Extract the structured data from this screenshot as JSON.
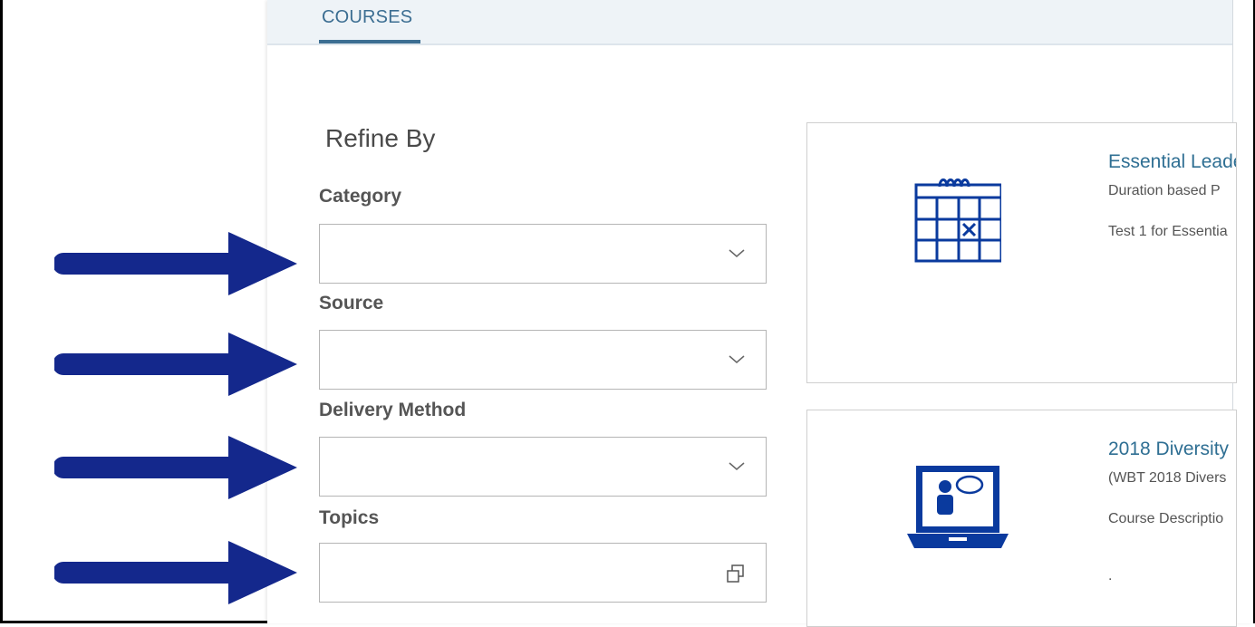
{
  "tabs": {
    "active_label": "COURSES"
  },
  "refine": {
    "title": "Refine By",
    "filters": [
      {
        "label": "Category",
        "value": "",
        "control": "dropdown"
      },
      {
        "label": "Source",
        "value": "",
        "control": "dropdown"
      },
      {
        "label": "Delivery Method",
        "value": "",
        "control": "dropdown"
      },
      {
        "label": "Topics",
        "value": "",
        "control": "value-help"
      }
    ]
  },
  "courses": [
    {
      "title": "Essential Leade",
      "line1": "Duration based P",
      "line2": "Test 1 for Essentia",
      "icon": "calendar-icon"
    },
    {
      "title": "2018 Diversity",
      "line1": "(WBT 2018 Divers",
      "line2": "Course Descriptio",
      "line3": ".",
      "icon": "laptop-presentation-icon"
    }
  ],
  "colors": {
    "arrow": "#14288c",
    "accent": "#3c6e92",
    "icon": "#0a3a9e",
    "link": "#2f6f93"
  }
}
